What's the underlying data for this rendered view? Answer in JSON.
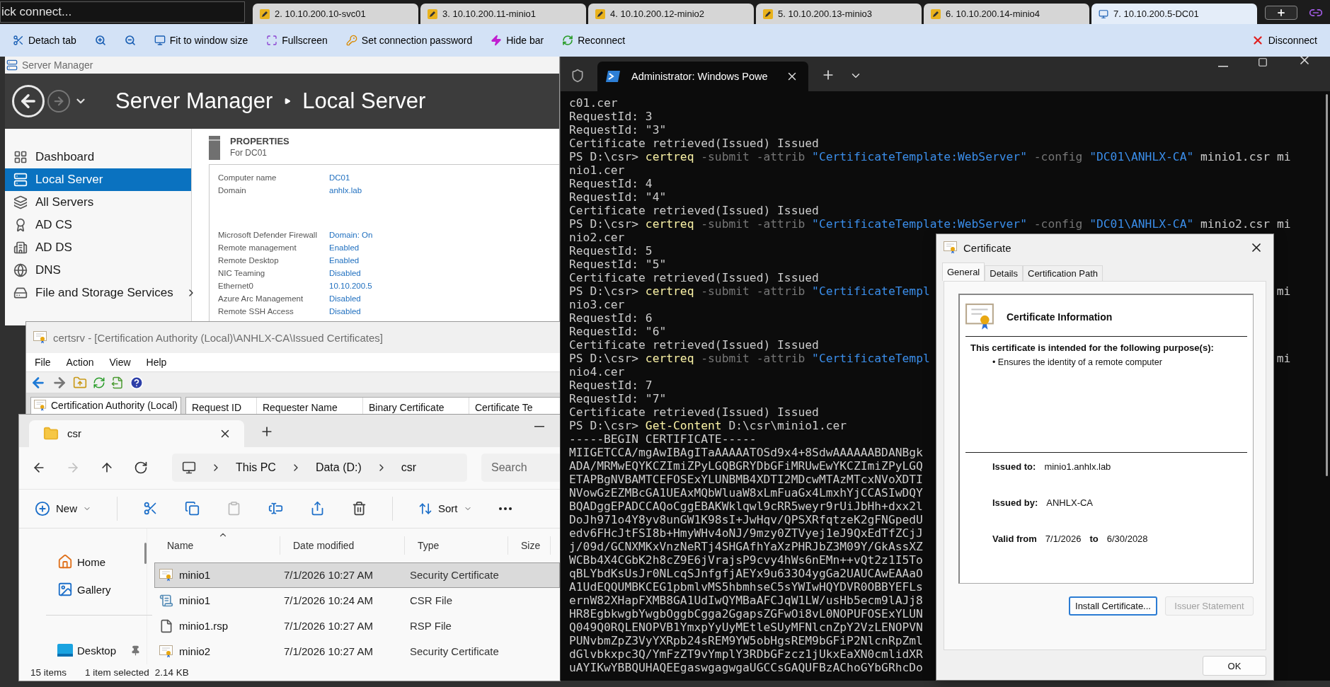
{
  "session_bar": {
    "quick_connect": "ick connect...",
    "tabs": [
      {
        "label": "2. 10.10.200.10-svc01",
        "selected": false
      },
      {
        "label": "3. 10.10.200.11-minio1",
        "selected": false
      },
      {
        "label": "4. 10.10.200.12-minio2",
        "selected": false
      },
      {
        "label": "5. 10.10.200.13-minio3",
        "selected": false
      },
      {
        "label": "6. 10.10.200.14-minio4",
        "selected": false
      },
      {
        "label": "7. 10.10.200.5-DC01",
        "selected": true
      }
    ]
  },
  "toolbar": {
    "items": [
      {
        "kind": "detach",
        "label": "Detach tab"
      },
      {
        "kind": "zoom_in"
      },
      {
        "kind": "zoom_out"
      },
      {
        "kind": "fit",
        "label": "Fit to window size"
      },
      {
        "kind": "fullscreen",
        "label": "Fullscreen"
      },
      {
        "kind": "password",
        "label": "Set connection password"
      },
      {
        "kind": "hide",
        "label": "Hide bar"
      },
      {
        "kind": "reconnect",
        "label": "Reconnect"
      }
    ],
    "disconnect": "Disconnect"
  },
  "server_manager": {
    "title": "Server Manager",
    "header": {
      "app": "Server Manager",
      "page": "Local Server"
    },
    "nav": [
      {
        "kind": "dashboard",
        "label": "Dashboard",
        "selected": false,
        "expandable": false
      },
      {
        "kind": "local",
        "label": "Local Server",
        "selected": true,
        "expandable": false
      },
      {
        "kind": "all",
        "label": "All Servers",
        "selected": false,
        "expandable": false
      },
      {
        "kind": "adcs",
        "label": "AD CS",
        "selected": false,
        "expandable": false
      },
      {
        "kind": "adds",
        "label": "AD DS",
        "selected": false,
        "expandable": false
      },
      {
        "kind": "dns",
        "label": "DNS",
        "selected": false,
        "expandable": false
      },
      {
        "kind": "files",
        "label": "File and Storage Services",
        "selected": false,
        "expandable": true
      }
    ],
    "properties": {
      "title": "PROPERTIES",
      "subtitle": "For DC01",
      "groups": [
        [
          {
            "label": "Computer name",
            "value": "DC01"
          },
          {
            "label": "Domain",
            "value": "anhlx.lab"
          }
        ],
        [
          {
            "label": "Microsoft Defender Firewall",
            "value": "Domain: On"
          },
          {
            "label": "Remote management",
            "value": "Enabled"
          },
          {
            "label": "Remote Desktop",
            "value": "Enabled"
          },
          {
            "label": "NIC Teaming",
            "value": "Disabled"
          },
          {
            "label": "Ethernet0",
            "value": "10.10.200.5"
          },
          {
            "label": "Azure Arc Management",
            "value": "Disabled"
          },
          {
            "label": "Remote SSH Access",
            "value": "Disabled"
          }
        ]
      ]
    }
  },
  "certsrv": {
    "title": "certsrv - [Certification Authority (Local)\\ANHLX-CA\\Issued Certificates]",
    "menu": [
      "File",
      "Action",
      "View",
      "Help"
    ],
    "tree_item": "Certification Authority (Local)",
    "columns": [
      "Request ID",
      "Requester Name",
      "Binary Certificate",
      "Certificate Te"
    ]
  },
  "explorer": {
    "tab": "csr",
    "breadcrumb": [
      "This PC",
      "Data (D:)",
      "csr"
    ],
    "search_placeholder": "Search",
    "nav_buttons": [
      {
        "kind": "back",
        "disabled": false
      },
      {
        "kind": "forward",
        "disabled": true
      },
      {
        "kind": "up",
        "disabled": false
      },
      {
        "kind": "refresh",
        "disabled": false
      }
    ],
    "new_label": "New",
    "sort_label": "Sort",
    "commands": [
      {
        "kind": "cut",
        "disabled": false
      },
      {
        "kind": "copy",
        "disabled": false
      },
      {
        "kind": "paste",
        "disabled": true
      },
      {
        "kind": "rename",
        "disabled": false
      },
      {
        "kind": "share",
        "disabled": false
      },
      {
        "kind": "delete",
        "disabled": false
      }
    ],
    "nav": [
      {
        "kind": "home",
        "label": "Home",
        "pinned": false
      },
      {
        "kind": "gallery",
        "label": "Gallery",
        "pinned": false
      },
      {
        "kind": "desktop",
        "label": "Desktop",
        "pinned": true
      }
    ],
    "columns": [
      "Name",
      "Date modified",
      "Type",
      "Size"
    ],
    "files": [
      {
        "kind": "certificate",
        "name": "minio1",
        "date": "7/1/2026 10:27 AM",
        "type": "Security Certificate",
        "selected": true
      },
      {
        "kind": "csr",
        "name": "minio1",
        "date": "7/1/2026 10:24 AM",
        "type": "CSR File",
        "selected": false
      },
      {
        "kind": "file",
        "name": "minio1.rsp",
        "date": "7/1/2026 10:27 AM",
        "type": "RSP File",
        "selected": false
      },
      {
        "kind": "certificate",
        "name": "minio2",
        "date": "7/1/2026 10:27 AM",
        "type": "Security Certificate",
        "selected": false
      }
    ],
    "status": {
      "count": "15 items",
      "selection": "1 item selected",
      "size": "2.14 KB"
    }
  },
  "terminal": {
    "tab_title": "Administrator: Windows Powe",
    "lines": [
      {
        "segments": [
          {
            "kind": "plain",
            "text": "c01.cer"
          }
        ]
      },
      {
        "segments": [
          {
            "kind": "plain",
            "text": "RequestId: 3"
          }
        ]
      },
      {
        "segments": [
          {
            "kind": "plain",
            "text": "RequestId: \"3\""
          }
        ]
      },
      {
        "segments": [
          {
            "kind": "plain",
            "text": "Certificate retrieved(Issued) Issued"
          }
        ]
      },
      {
        "segments": [
          {
            "kind": "plain",
            "text": "PS D:\\csr> "
          },
          {
            "kind": "command",
            "text": "certreq"
          },
          {
            "kind": "param",
            "text": " -submit -attrib "
          },
          {
            "kind": "string",
            "text": "\"CertificateTemplate:WebServer\""
          },
          {
            "kind": "param",
            "text": " -config "
          },
          {
            "kind": "string",
            "text": "\"DC01\\ANHLX-CA\""
          },
          {
            "kind": "plain",
            "text": " minio1.csr mi"
          }
        ]
      },
      {
        "segments": [
          {
            "kind": "plain",
            "text": "nio1.cer"
          }
        ]
      },
      {
        "segments": [
          {
            "kind": "plain",
            "text": "RequestId: 4"
          }
        ]
      },
      {
        "segments": [
          {
            "kind": "plain",
            "text": "RequestId: \"4\""
          }
        ]
      },
      {
        "segments": [
          {
            "kind": "plain",
            "text": "Certificate retrieved(Issued) Issued"
          }
        ]
      },
      {
        "segments": [
          {
            "kind": "plain",
            "text": "PS D:\\csr> "
          },
          {
            "kind": "command",
            "text": "certreq"
          },
          {
            "kind": "param",
            "text": " -submit -attrib "
          },
          {
            "kind": "string",
            "text": "\"CertificateTemplate:WebServer\""
          },
          {
            "kind": "param",
            "text": " -config "
          },
          {
            "kind": "string",
            "text": "\"DC01\\ANHLX-CA\""
          },
          {
            "kind": "plain",
            "text": " minio2.csr mi"
          }
        ]
      },
      {
        "segments": [
          {
            "kind": "plain",
            "text": "nio2.cer"
          }
        ]
      },
      {
        "segments": [
          {
            "kind": "plain",
            "text": "RequestId: 5"
          }
        ]
      },
      {
        "segments": [
          {
            "kind": "plain",
            "text": "RequestId: \"5\""
          }
        ]
      },
      {
        "segments": [
          {
            "kind": "plain",
            "text": "Certificate retrieved(Issued) Issued"
          }
        ]
      },
      {
        "segments": [
          {
            "kind": "plain",
            "text": "PS D:\\csr> "
          },
          {
            "kind": "command",
            "text": "certreq"
          },
          {
            "kind": "param",
            "text": " -submit -attrib "
          },
          {
            "kind": "string",
            "text": "\"CertificateTempl"
          }
        ],
        "tail": "mi"
      },
      {
        "segments": [
          {
            "kind": "plain",
            "text": "nio3.cer"
          }
        ]
      },
      {
        "segments": [
          {
            "kind": "plain",
            "text": "RequestId: 6"
          }
        ]
      },
      {
        "segments": [
          {
            "kind": "plain",
            "text": "RequestId: \"6\""
          }
        ]
      },
      {
        "segments": [
          {
            "kind": "plain",
            "text": "Certificate retrieved(Issued) Issued"
          }
        ]
      },
      {
        "segments": [
          {
            "kind": "plain",
            "text": "PS D:\\csr> "
          },
          {
            "kind": "command",
            "text": "certreq"
          },
          {
            "kind": "param",
            "text": " -submit -attrib "
          },
          {
            "kind": "string",
            "text": "\"CertificateTempl"
          }
        ],
        "tail": "mi"
      },
      {
        "segments": [
          {
            "kind": "plain",
            "text": "nio4.cer"
          }
        ]
      },
      {
        "segments": [
          {
            "kind": "plain",
            "text": "RequestId: 7"
          }
        ]
      },
      {
        "segments": [
          {
            "kind": "plain",
            "text": "RequestId: \"7\""
          }
        ]
      },
      {
        "segments": [
          {
            "kind": "plain",
            "text": "Certificate retrieved(Issued) Issued"
          }
        ]
      },
      {
        "segments": [
          {
            "kind": "plain",
            "text": "PS D:\\csr> "
          },
          {
            "kind": "command",
            "text": "Get-Content"
          },
          {
            "kind": "plain",
            "text": " D:\\csr\\minio1.cer"
          }
        ]
      },
      {
        "segments": [
          {
            "kind": "plain",
            "text": "-----BEGIN CERTIFICATE-----"
          }
        ]
      },
      {
        "segments": [
          {
            "kind": "plain",
            "text": "MIIGETCCA/mgAwIBAgITaAAAAATOSd9x4+8SdwAAAAAABDANBgk"
          }
        ]
      },
      {
        "segments": [
          {
            "kind": "plain",
            "text": "ADA/MRMwEQYKCZImiZPyLGQBGRYDbGFiMRUwEwYKCZImiZPyLGQ"
          }
        ]
      },
      {
        "segments": [
          {
            "kind": "plain",
            "text": "ETAPBgNVBAMTCEFOSExYLUNBMB4XDTI2MDcwMTAzMTcxNVoXDTI"
          }
        ]
      },
      {
        "segments": [
          {
            "kind": "plain",
            "text": "NVowGzEZMBcGA1UEAxMQbWluaW8xLmFuaGx4LmxhYjCCASIwDQY"
          }
        ]
      },
      {
        "segments": [
          {
            "kind": "plain",
            "text": "BQADggEPADCCAQoCggEBAKWklqwl9cRR5weyr9rUiJbHh+dxx2l"
          }
        ]
      },
      {
        "segments": [
          {
            "kind": "plain",
            "text": "DoJh971o4Y8yv8unGW1K98sI+JwHqv/QPSXRfqtzeK2gFNGpedU"
          }
        ]
      },
      {
        "segments": [
          {
            "kind": "plain",
            "text": "edv6FHcJtFSI8b+HmyWHv4oNJ/9mzy0ZTVyej1eJ9QxEdTfZCjJ"
          }
        ]
      },
      {
        "segments": [
          {
            "kind": "plain",
            "text": "j/09d/GCNXMKxVnzNeRTj4SHGAfhYaXzPHRJbZ3M09Y/GkAssXZ"
          }
        ]
      },
      {
        "segments": [
          {
            "kind": "plain",
            "text": "WCBb4X4CGbK2h8cZ9E6jVrajsP9cvy4hWs6nEMn++vQt2z1I5To"
          }
        ]
      },
      {
        "segments": [
          {
            "kind": "plain",
            "text": "qBLYbdKsUsJr0NLcqSJnfgfjAEYx9u633O4ygGa2UAUCAwEAAaO"
          }
        ]
      },
      {
        "segments": [
          {
            "kind": "plain",
            "text": "A1UdEQQUMBKCEG1pbmlvMS5hbmhseC5sYWIwHQYDVR0OBBYEFLs"
          }
        ]
      },
      {
        "segments": [
          {
            "kind": "plain",
            "text": "ernW82XHapFXMB8GA1UdIwQYMBaAFCJqW1LW/usHb5ecm9lAJj8"
          }
        ]
      },
      {
        "segments": [
          {
            "kind": "plain",
            "text": "HR8EgbkwgbYwgbOggbCgga2GgapsZGFwOi8vL0NOPUFOSExYLUN"
          }
        ]
      },
      {
        "segments": [
          {
            "kind": "plain",
            "text": "Q049Q0RQLENOPVB1YmxpYyUyMEtleSUyMFNlcnZpY2VzLENOPVN"
          }
        ]
      },
      {
        "segments": [
          {
            "kind": "plain",
            "text": "PUNvbmZpZ3VyYXRpb24sREM9YW5obHgsREM9bGFiP2NlcnRpZml"
          }
        ]
      },
      {
        "segments": [
          {
            "kind": "plain",
            "text": "dGlvbkxpc3Q/YmFzZT9vYmplY3RDbGFzcz1jUkxEaXN0cmlidXR"
          }
        ]
      },
      {
        "segments": [
          {
            "kind": "plain",
            "text": "uAYIKwYBBQUHAQEEgaswgagwgaUGCCsGAQUFBzAChoGYbGRhcDo"
          }
        ]
      }
    ]
  },
  "certificate_dialog": {
    "title": "Certificate",
    "tabs": [
      {
        "label": "General",
        "selected": true
      },
      {
        "label": "Details",
        "selected": false
      },
      {
        "label": "Certification Path",
        "selected": false
      }
    ],
    "heading": "Certificate Information",
    "purpose_title": "This certificate is intended for the following purpose(s):",
    "purposes": [
      "• Ensures the identity of a remote computer"
    ],
    "issued_to": {
      "label": "Issued to:",
      "value": "minio1.anhlx.lab"
    },
    "issued_by": {
      "label": "Issued by:",
      "value": "ANHLX-CA"
    },
    "validity": {
      "from_label": "Valid from",
      "from": "7/1/2026",
      "to_label": "to",
      "to": "6/30/2028"
    },
    "buttons": [
      {
        "label": "Install Certificate...",
        "disabled": false
      },
      {
        "label": "Issuer Statement",
        "disabled": true
      }
    ],
    "ok": "OK"
  }
}
